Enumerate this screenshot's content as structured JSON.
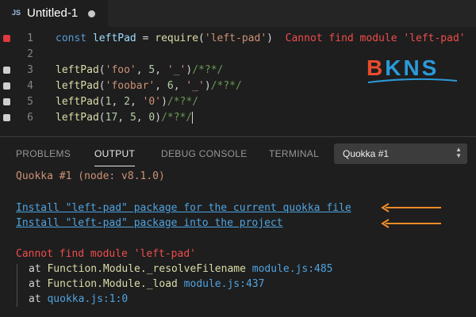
{
  "tab": {
    "lang_badge": "JS",
    "title": "Untitled-1"
  },
  "editor": {
    "lines": [
      {
        "number": "1",
        "marker_color": "#e0393e",
        "tokens": [
          {
            "text": "const ",
            "cls": "kw"
          },
          {
            "text": "leftPad",
            "cls": "id"
          },
          {
            "text": " = ",
            "cls": ""
          },
          {
            "text": "require",
            "cls": "fn"
          },
          {
            "text": "(",
            "cls": ""
          },
          {
            "text": "'left-pad'",
            "cls": "str"
          },
          {
            "text": ")",
            "cls": ""
          }
        ],
        "inline_error": "Cannot find module 'left-pad'"
      },
      {
        "number": "2",
        "marker_color": "",
        "tokens": [],
        "inline_error": ""
      },
      {
        "number": "3",
        "marker_color": "#cfcfcf",
        "tokens": [
          {
            "text": "leftPad",
            "cls": "fn"
          },
          {
            "text": "(",
            "cls": ""
          },
          {
            "text": "'foo'",
            "cls": "str"
          },
          {
            "text": ", ",
            "cls": ""
          },
          {
            "text": "5",
            "cls": "num"
          },
          {
            "text": ", ",
            "cls": ""
          },
          {
            "text": "'_'",
            "cls": "str"
          },
          {
            "text": ")",
            "cls": ""
          },
          {
            "text": "/*?*/",
            "cls": "cmt"
          }
        ],
        "inline_error": ""
      },
      {
        "number": "4",
        "marker_color": "#cfcfcf",
        "tokens": [
          {
            "text": "leftPad",
            "cls": "fn"
          },
          {
            "text": "(",
            "cls": ""
          },
          {
            "text": "'foobar'",
            "cls": "str"
          },
          {
            "text": ", ",
            "cls": ""
          },
          {
            "text": "6",
            "cls": "num"
          },
          {
            "text": ", ",
            "cls": ""
          },
          {
            "text": "'_'",
            "cls": "str"
          },
          {
            "text": ")",
            "cls": ""
          },
          {
            "text": "/*?*/",
            "cls": "cmt"
          }
        ],
        "inline_error": ""
      },
      {
        "number": "5",
        "marker_color": "#cfcfcf",
        "tokens": [
          {
            "text": "leftPad",
            "cls": "fn"
          },
          {
            "text": "(",
            "cls": ""
          },
          {
            "text": "1",
            "cls": "num"
          },
          {
            "text": ", ",
            "cls": ""
          },
          {
            "text": "2",
            "cls": "num"
          },
          {
            "text": ", ",
            "cls": ""
          },
          {
            "text": "'0'",
            "cls": "str"
          },
          {
            "text": ")",
            "cls": ""
          },
          {
            "text": "/*?*/",
            "cls": "cmt"
          }
        ],
        "inline_error": ""
      },
      {
        "number": "6",
        "marker_color": "#cfcfcf",
        "tokens": [
          {
            "text": "leftPad",
            "cls": "fn"
          },
          {
            "text": "(",
            "cls": ""
          },
          {
            "text": "17",
            "cls": "num"
          },
          {
            "text": ", ",
            "cls": ""
          },
          {
            "text": "5",
            "cls": "num"
          },
          {
            "text": ", ",
            "cls": ""
          },
          {
            "text": "0",
            "cls": "num"
          },
          {
            "text": ")",
            "cls": ""
          },
          {
            "text": "/*?*/",
            "cls": "cmt"
          }
        ],
        "inline_error": "",
        "cursor": true
      }
    ]
  },
  "logo": {
    "first_letter": "B",
    "rest": "KNS",
    "first_color": "#e84c2c",
    "rest_color": "#2b9ad9"
  },
  "panel": {
    "tabs": [
      {
        "label": "PROBLEMS",
        "active": false
      },
      {
        "label": "OUTPUT",
        "active": true
      },
      {
        "label": "DEBUG CONSOLE",
        "active": false
      },
      {
        "label": "TERMINAL",
        "active": false
      }
    ],
    "channel_select": {
      "value": "Quokka #1"
    },
    "output": {
      "header": "Quokka #1 (node: v8.1.0)",
      "links": [
        "Install \"left-pad\" package for the current quokka file",
        "Install \"left-pad\" package into the project"
      ],
      "error_title": "Cannot find module 'left-pad'",
      "stack": [
        {
          "at": "at ",
          "fn": "Function.Module._resolveFilename ",
          "file": "module.js:485"
        },
        {
          "at": "at ",
          "fn": "Function.Module._load ",
          "file": "module.js:437"
        },
        {
          "at": "at ",
          "fn": "",
          "file": "quokka.js:1:0"
        }
      ]
    },
    "arrow_color": "#f28c28"
  },
  "colors": {
    "editor_bg": "#1e1e1e",
    "tabbar_bg": "#252526",
    "error_red": "#f14c4c",
    "link_blue": "#4fa3e0"
  }
}
